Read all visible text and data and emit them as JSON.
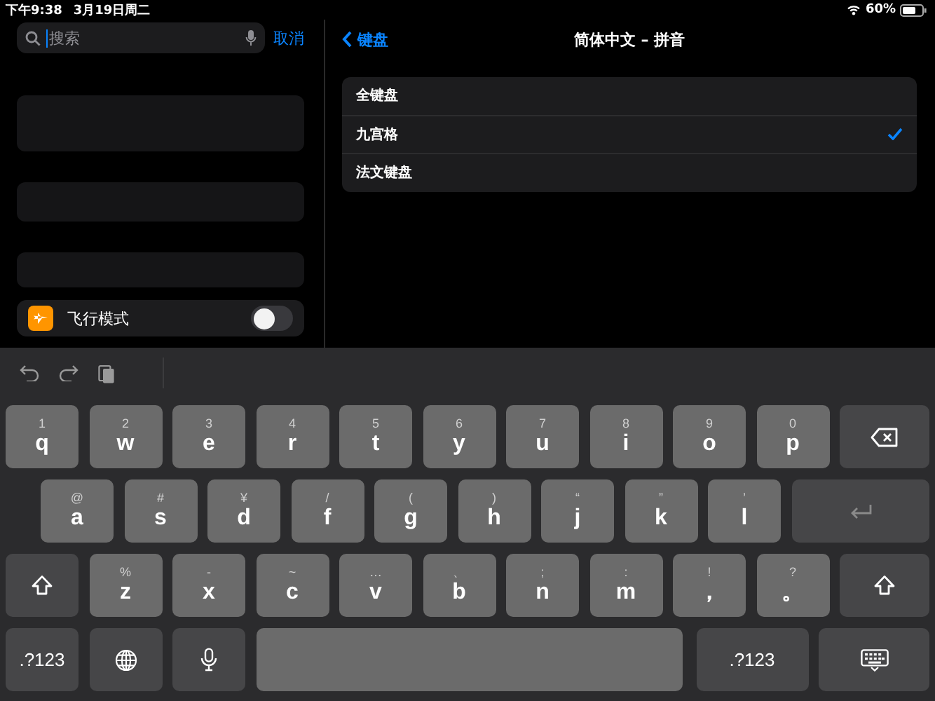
{
  "status_bar": {
    "time": "下午9:38",
    "date": "3月19日周二",
    "battery": "60%"
  },
  "search": {
    "placeholder": "搜索",
    "cancel": "取消"
  },
  "settings_rows": [
    {
      "label": "飞行模式",
      "on": false
    }
  ],
  "nav": {
    "back": "键盘",
    "title": "简体中文 – 拼音"
  },
  "options": [
    {
      "label": "全键盘",
      "selected": false
    },
    {
      "label": "九宫格",
      "selected": true
    },
    {
      "label": "法文键盘",
      "selected": false
    }
  ],
  "keyboard": {
    "rows": [
      [
        {
          "kind": "letter",
          "label": "q",
          "alt": "1"
        },
        {
          "kind": "letter",
          "label": "w",
          "alt": "2"
        },
        {
          "kind": "letter",
          "label": "e",
          "alt": "3"
        },
        {
          "kind": "letter",
          "label": "r",
          "alt": "4"
        },
        {
          "kind": "letter",
          "label": "t",
          "alt": "5"
        },
        {
          "kind": "letter",
          "label": "y",
          "alt": "6"
        },
        {
          "kind": "letter",
          "label": "u",
          "alt": "7"
        },
        {
          "kind": "letter",
          "label": "i",
          "alt": "8"
        },
        {
          "kind": "letter",
          "label": "o",
          "alt": "9"
        },
        {
          "kind": "letter",
          "label": "p",
          "alt": "0"
        },
        {
          "kind": "delete"
        }
      ],
      [
        {
          "kind": "letter",
          "label": "a",
          "alt": "@"
        },
        {
          "kind": "letter",
          "label": "s",
          "alt": "#"
        },
        {
          "kind": "letter",
          "label": "d",
          "alt": "¥"
        },
        {
          "kind": "letter",
          "label": "f",
          "alt": "/"
        },
        {
          "kind": "letter",
          "label": "g",
          "alt": "("
        },
        {
          "kind": "letter",
          "label": "h",
          "alt": ")"
        },
        {
          "kind": "letter",
          "label": "j",
          "alt": "“"
        },
        {
          "kind": "letter",
          "label": "k",
          "alt": "”"
        },
        {
          "kind": "letter",
          "label": "l",
          "alt": "’"
        },
        {
          "kind": "return"
        }
      ],
      [
        {
          "kind": "shift"
        },
        {
          "kind": "letter",
          "label": "z",
          "alt": "%"
        },
        {
          "kind": "letter",
          "label": "x",
          "alt": "-"
        },
        {
          "kind": "letter",
          "label": "c",
          "alt": "~"
        },
        {
          "kind": "letter",
          "label": "v",
          "alt": "…"
        },
        {
          "kind": "letter",
          "label": "b",
          "alt": "、"
        },
        {
          "kind": "letter",
          "label": "n",
          "alt": ";"
        },
        {
          "kind": "letter",
          "label": "m",
          "alt": ":"
        },
        {
          "kind": "letter",
          "label": "，",
          "alt": "!"
        },
        {
          "kind": "letter",
          "label": "。",
          "alt": "?"
        },
        {
          "kind": "shift"
        }
      ],
      [
        {
          "kind": "symbols",
          "label": ".?123"
        },
        {
          "kind": "globe"
        },
        {
          "kind": "mic"
        },
        {
          "kind": "space"
        },
        {
          "kind": "symbols",
          "label": ".?123"
        },
        {
          "kind": "hide"
        }
      ]
    ]
  }
}
